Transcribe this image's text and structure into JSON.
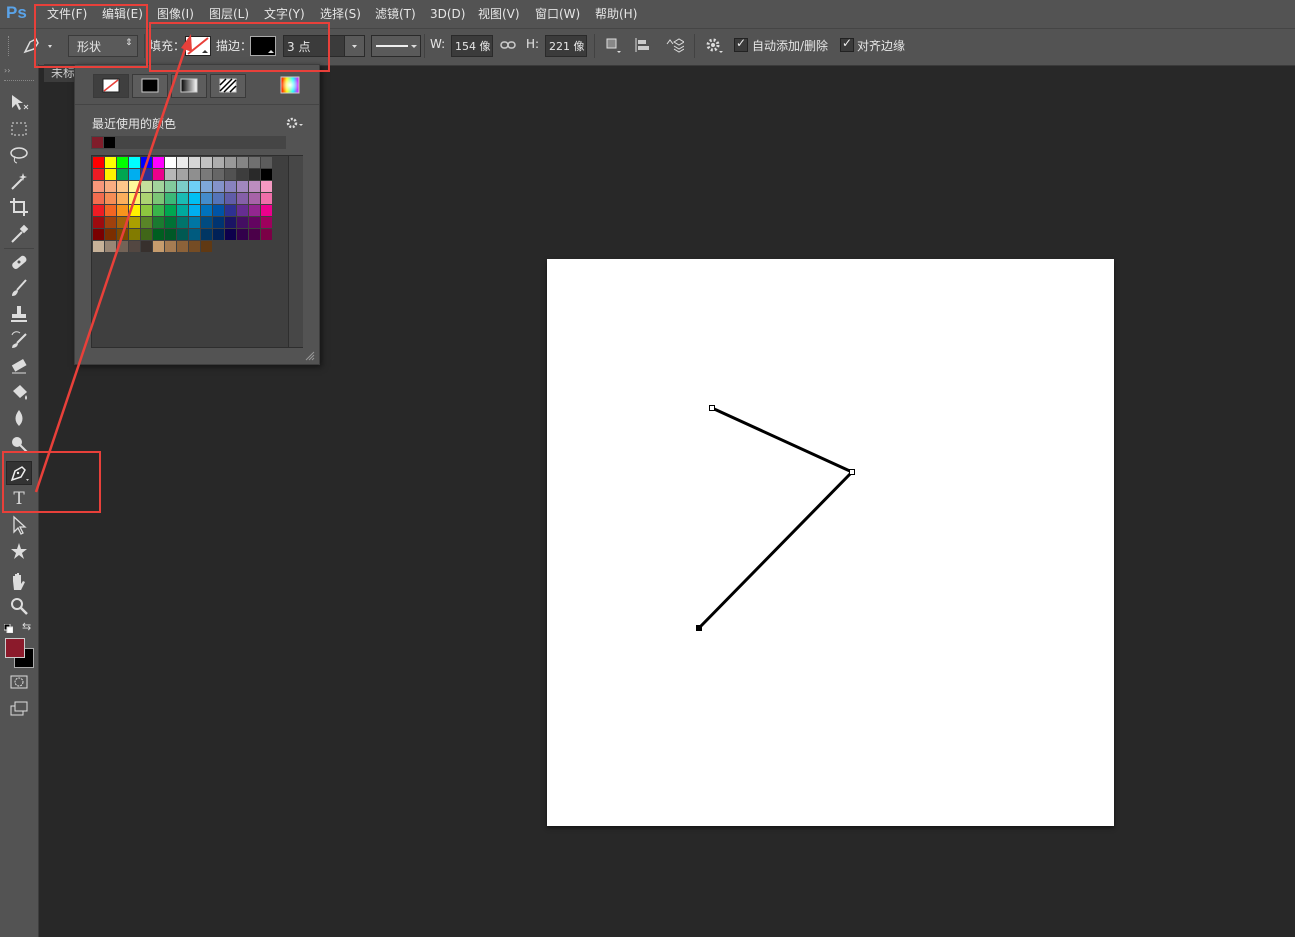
{
  "app": {
    "logo": "Ps"
  },
  "menu": [
    "文件(F)",
    "编辑(E)",
    "图像(I)",
    "图层(L)",
    "文字(Y)",
    "选择(S)",
    "滤镜(T)",
    "3D(D)",
    "视图(V)",
    "窗口(W)",
    "帮助(H)"
  ],
  "options": {
    "mode": "形状",
    "fill_label": "填充：",
    "stroke_label": "描边：",
    "stroke_width": "3 点",
    "w_label": "W:",
    "w_value": "154 像",
    "h_label": "H:",
    "h_value": "221 像",
    "auto_add_delete": "自动添加/删除",
    "align_edges": "对齐边缘",
    "auto_add_checked": true,
    "align_checked": true
  },
  "document_tab": "未标",
  "swatch_panel": {
    "recent_label": "最近使用的颜色",
    "recent_colors": [
      "#7f1d2a",
      "#000000"
    ],
    "rows": [
      [
        "#ff0000",
        "#ffff00",
        "#00ff00",
        "#00ffff",
        "#0000ff",
        "#ff00ff",
        "#ffffff",
        "#ebebeb",
        "#d6d6d6",
        "#c2c2c2",
        "#adadad",
        "#999999",
        "#858585",
        "#707070",
        "#5c5c5c"
      ],
      [
        "#ed1c24",
        "#fff200",
        "#00a651",
        "#00aeef",
        "#2e3192",
        "#ec008c",
        "#b7b7b7",
        "#a3a3a3",
        "#8f8f8f",
        "#7a7a7a",
        "#666666",
        "#525252",
        "#3d3d3d",
        "#292929",
        "#000000"
      ],
      [
        "#f7977a",
        "#f9ad81",
        "#fdc68a",
        "#fff79a",
        "#c4df9b",
        "#a2d39c",
        "#82ca9d",
        "#7bcdc8",
        "#6ecff6",
        "#7ea7d8",
        "#8493ca",
        "#8882be",
        "#a187be",
        "#bc8dbf",
        "#f49ac2"
      ],
      [
        "#f26c4f",
        "#f68e56",
        "#fbaf5d",
        "#fff467",
        "#acd372",
        "#7cc576",
        "#3bb878",
        "#1abbb4",
        "#00bff3",
        "#438ccb",
        "#5574b9",
        "#605ca8",
        "#855fa8",
        "#a763a8",
        "#f06ea9"
      ],
      [
        "#ed1c24",
        "#f26522",
        "#f7941d",
        "#fff200",
        "#8dc63f",
        "#39b54a",
        "#00a651",
        "#00a99d",
        "#00aeef",
        "#0072bc",
        "#0054a6",
        "#2e3192",
        "#662d91",
        "#92278f",
        "#ec008c"
      ],
      [
        "#9e0b0f",
        "#a0410d",
        "#a36209",
        "#aba000",
        "#598527",
        "#1a7b30",
        "#007236",
        "#00746b",
        "#0076a3",
        "#004b80",
        "#003471",
        "#1b1464",
        "#440e62",
        "#630460",
        "#9e005d"
      ],
      [
        "#790000",
        "#7b2e00",
        "#7d4900",
        "#827b00",
        "#406618",
        "#005e20",
        "#005826",
        "#005952",
        "#005b7f",
        "#003663",
        "#002157",
        "#0d004c",
        "#32004b",
        "#4b0049",
        "#7b0046"
      ],
      [
        "#c7b299",
        "#998675",
        "#736357",
        "#534741",
        "#37302d",
        "#c69c6d",
        "#a67c52",
        "#8c6239",
        "#754c24",
        "#603913"
      ]
    ]
  },
  "path": {
    "stroke_color": "#000000",
    "stroke_width": "3 点"
  },
  "colors": {
    "foreground": "#8b1a2b",
    "background": "#000000",
    "annotation": "#e8403a"
  }
}
